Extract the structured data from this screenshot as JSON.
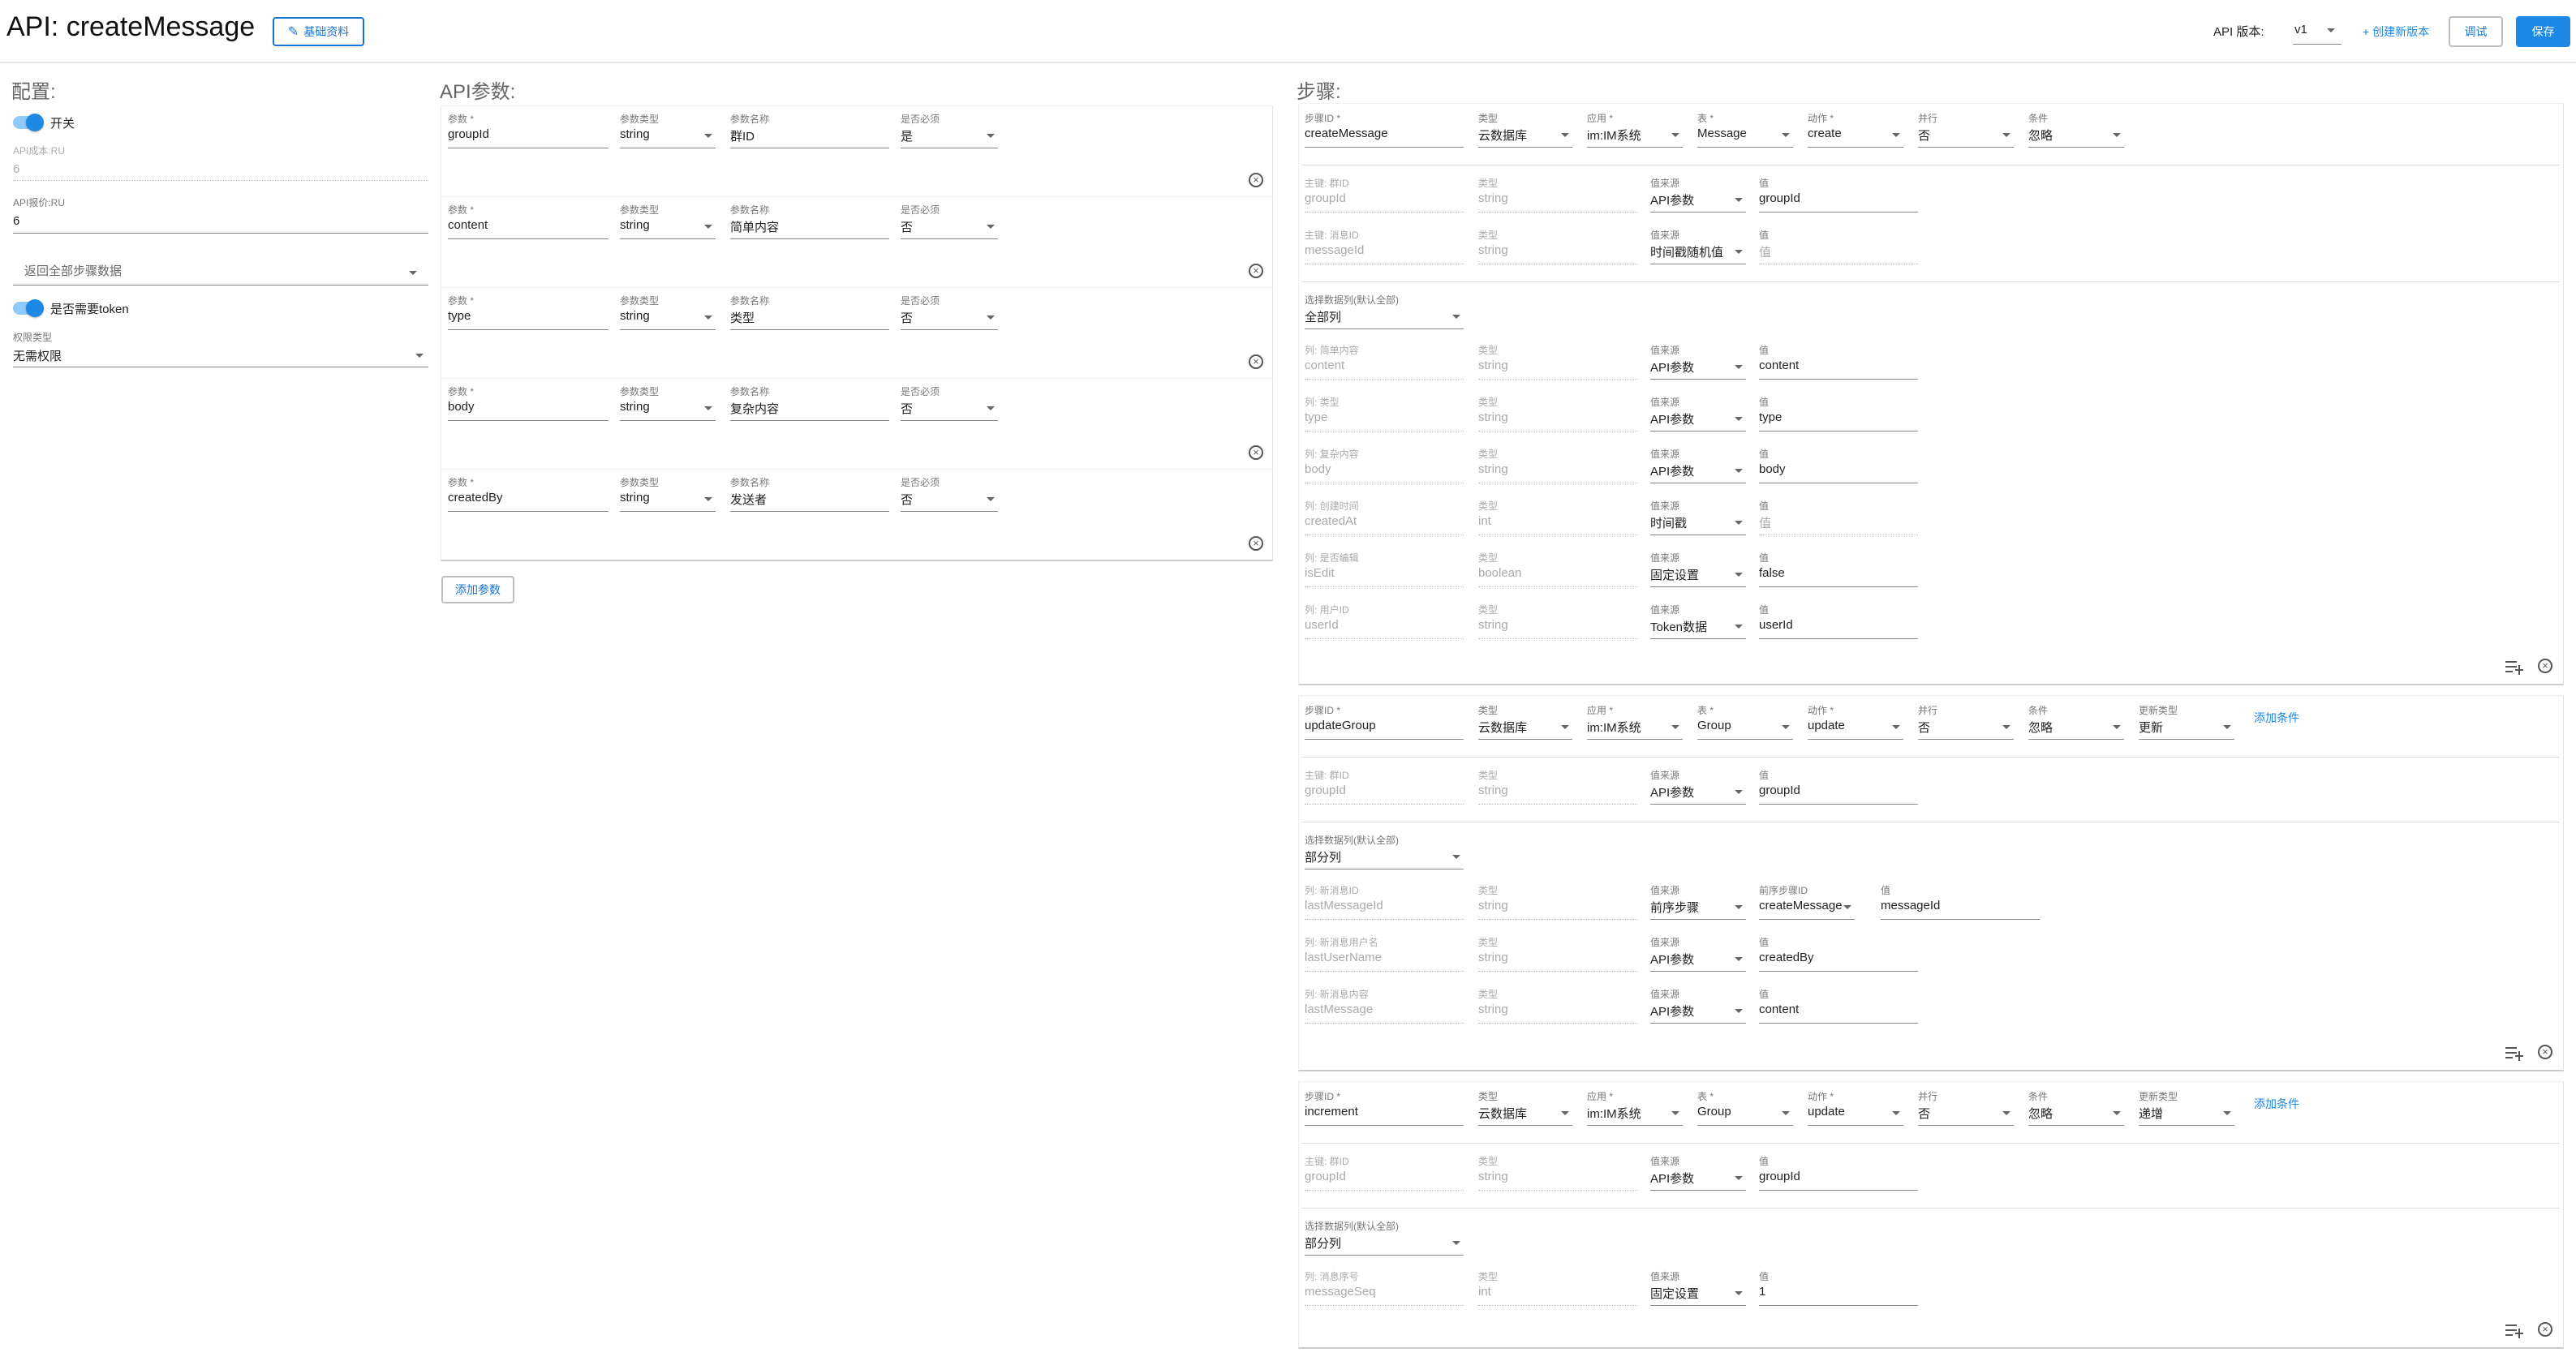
{
  "header": {
    "title": "API: createMessage",
    "basic_info_label": "基础资料",
    "version_label": "API 版本:",
    "version_value": "v1",
    "create_version_label": "+ 创建新版本",
    "debug_label": "调试",
    "save_label": "保存"
  },
  "config": {
    "title": "配置:",
    "switch_label": "开关",
    "cost_ru_label": "API成本:RU",
    "cost_ru_value": "6",
    "price_ru_label": "API报价:RU",
    "price_ru_value": "6",
    "return_select": "返回全部步骤数据",
    "token_label": "是否需要token",
    "perm_type_label": "权限类型",
    "perm_type_value": "无需权限"
  },
  "params": {
    "title": "API参数:",
    "col_labels": {
      "param": "参数 *",
      "type": "参数类型",
      "name": "参数名称",
      "required": "是否必须"
    },
    "rows": [
      {
        "param": "groupId",
        "type": "string",
        "name": "群ID",
        "required": "是"
      },
      {
        "param": "content",
        "type": "string",
        "name": "简单内容",
        "required": "否"
      },
      {
        "param": "type",
        "type": "string",
        "name": "类型",
        "required": "否"
      },
      {
        "param": "body",
        "type": "string",
        "name": "复杂内容",
        "required": "否"
      },
      {
        "param": "createdBy",
        "type": "string",
        "name": "发送者",
        "required": "否"
      }
    ],
    "add_label": "添加参数"
  },
  "steps": {
    "title": "步骤:",
    "head_labels": {
      "step_id": "步骤ID *",
      "type": "类型",
      "app": "应用 *",
      "table": "表 *",
      "action": "动作 *",
      "parallel": "并行",
      "condition": "条件",
      "update_type": "更新类型"
    },
    "col_type_label": "类型",
    "src_label": "值来源",
    "val_label": "值",
    "prev_step_label": "前序步骤ID",
    "select_cols_label": "选择数据列(默认全部)",
    "add_condition_label": "添加条件",
    "list": [
      {
        "step_id": "createMessage",
        "type": "云数据库",
        "app": "im:IM系统",
        "table": "Message",
        "action": "create",
        "parallel": "否",
        "condition": "忽略",
        "keys": [
          {
            "label": "主键: 群ID",
            "name": "groupId",
            "ctype": "string",
            "src": "API参数",
            "val": "groupId",
            "val_dis": false
          },
          {
            "label": "主键: 消息ID",
            "name": "messageId",
            "ctype": "string",
            "src": "时间戳随机值",
            "val": "值",
            "val_dis": true
          }
        ],
        "col_select": "全部列",
        "cols": [
          {
            "label": "列: 简单内容",
            "name": "content",
            "ctype": "string",
            "src": "API参数",
            "val": "content",
            "val_dis": false
          },
          {
            "label": "列: 类型",
            "name": "type",
            "ctype": "string",
            "src": "API参数",
            "val": "type",
            "val_dis": false
          },
          {
            "label": "列: 复杂内容",
            "name": "body",
            "ctype": "string",
            "src": "API参数",
            "val": "body",
            "val_dis": false
          },
          {
            "label": "列: 创建时间",
            "name": "createdAt",
            "ctype": "int",
            "src": "时间戳",
            "val": "值",
            "val_dis": true
          },
          {
            "label": "列: 是否编辑",
            "name": "isEdit",
            "ctype": "boolean",
            "src": "固定设置",
            "val": "false",
            "val_dis": false
          },
          {
            "label": "列: 用户ID",
            "name": "userId",
            "ctype": "string",
            "src": "Token数据",
            "val": "userId",
            "val_dis": false
          }
        ]
      },
      {
        "step_id": "updateGroup",
        "type": "云数据库",
        "app": "im:IM系统",
        "table": "Group",
        "action": "update",
        "parallel": "否",
        "condition": "忽略",
        "update_type": "更新",
        "keys": [
          {
            "label": "主键: 群ID",
            "name": "groupId",
            "ctype": "string",
            "src": "API参数",
            "val": "groupId",
            "val_dis": false
          }
        ],
        "col_select": "部分列",
        "cols": [
          {
            "label": "列: 新消息ID",
            "name": "lastMessageId",
            "ctype": "string",
            "src": "前序步骤",
            "prev": "createMessage",
            "val": "messageId",
            "val_dis": false
          },
          {
            "label": "列: 新消息用户名",
            "name": "lastUserName",
            "ctype": "string",
            "src": "API参数",
            "val": "createdBy",
            "val_dis": false
          },
          {
            "label": "列: 新消息内容",
            "name": "lastMessage",
            "ctype": "string",
            "src": "API参数",
            "val": "content",
            "val_dis": false
          }
        ]
      },
      {
        "step_id": "increment",
        "type": "云数据库",
        "app": "im:IM系统",
        "table": "Group",
        "action": "update",
        "parallel": "否",
        "condition": "忽略",
        "update_type": "递增",
        "keys": [
          {
            "label": "主键: 群ID",
            "name": "groupId",
            "ctype": "string",
            "src": "API参数",
            "val": "groupId",
            "val_dis": false
          }
        ],
        "col_select": "部分列",
        "cols": [
          {
            "label": "列: 消息序号",
            "name": "messageSeq",
            "ctype": "int",
            "src": "固定设置",
            "val": "1",
            "val_dis": false
          }
        ]
      }
    ]
  }
}
